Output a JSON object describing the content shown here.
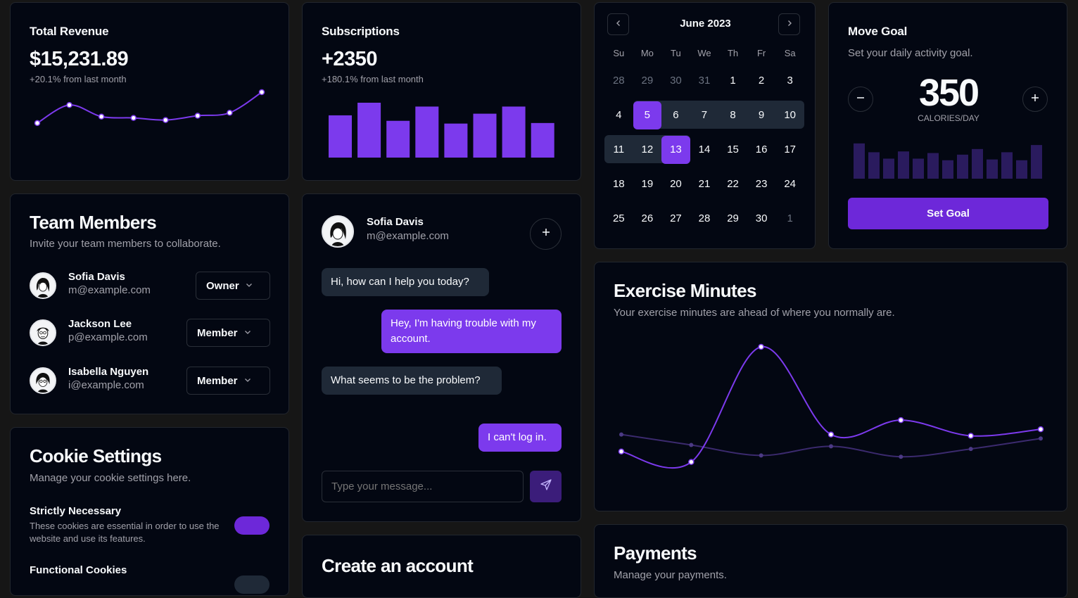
{
  "revenue": {
    "title": "Total Revenue",
    "value": "$15,231.89",
    "change": "+20.1% from last month",
    "points": [
      0.28,
      0.7,
      0.43,
      0.4,
      0.35,
      0.45,
      0.52,
      1.0
    ]
  },
  "subs": {
    "title": "Subscriptions",
    "value": "+2350",
    "change": "+180.1% from last month",
    "bars": [
      0.77,
      1.0,
      0.67,
      0.93,
      0.62,
      0.8,
      0.93,
      0.63
    ]
  },
  "calendar": {
    "month": "June 2023",
    "weekdays": [
      "Su",
      "Mo",
      "Tu",
      "We",
      "Th",
      "Fr",
      "Sa"
    ],
    "weeks": [
      [
        "28",
        "29",
        "30",
        "31",
        "1",
        "2",
        "3"
      ],
      [
        "4",
        "5",
        "6",
        "7",
        "8",
        "9",
        "10"
      ],
      [
        "11",
        "12",
        "13",
        "14",
        "15",
        "16",
        "17"
      ],
      [
        "18",
        "19",
        "20",
        "21",
        "22",
        "23",
        "24"
      ],
      [
        "25",
        "26",
        "27",
        "28",
        "29",
        "30",
        "1"
      ]
    ]
  },
  "goal": {
    "title": "Move Goal",
    "desc": "Set your daily activity goal.",
    "value": "350",
    "unit": "CALORIES/DAY",
    "button": "Set Goal",
    "bars": [
      0.88,
      0.66,
      0.5,
      0.68,
      0.5,
      0.64,
      0.46,
      0.6,
      0.74,
      0.48,
      0.66,
      0.46,
      0.84
    ]
  },
  "team": {
    "title": "Team Members",
    "desc": "Invite your team members to collaborate.",
    "members": [
      {
        "name": "Sofia Davis",
        "email": "m@example.com",
        "role": "Owner"
      },
      {
        "name": "Jackson Lee",
        "email": "p@example.com",
        "role": "Member"
      },
      {
        "name": "Isabella Nguyen",
        "email": "i@example.com",
        "role": "Member"
      }
    ]
  },
  "chat": {
    "name": "Sofia Davis",
    "email": "m@example.com",
    "messages": [
      {
        "text": "Hi, how can I help you today?",
        "from": "agent"
      },
      {
        "text": "Hey, I'm having trouble with my account.",
        "from": "user"
      },
      {
        "text": "What seems to be the problem?",
        "from": "agent"
      },
      {
        "text": "I can't log in.",
        "from": "user"
      }
    ],
    "placeholder": "Type your message..."
  },
  "exercise": {
    "title": "Exercise Minutes",
    "desc": "Your exercise minutes are ahead of where you normally are.",
    "current": [
      0.2,
      0.12,
      1.0,
      0.33,
      0.44,
      0.32,
      0.37
    ],
    "average": [
      0.33,
      0.25,
      0.17,
      0.24,
      0.16,
      0.22,
      0.3
    ]
  },
  "cookies": {
    "title": "Cookie Settings",
    "desc": "Manage your cookie settings here.",
    "items": [
      {
        "label": "Strictly Necessary",
        "desc": "These cookies are essential in order to use the website and use its features.",
        "on": true
      },
      {
        "label": "Functional Cookies",
        "desc": "",
        "on": false
      }
    ]
  },
  "account": {
    "title": "Create an account"
  },
  "payments": {
    "title": "Payments",
    "desc": "Manage your payments."
  },
  "colors": {
    "accent": "#7c3aed",
    "card": "#030712",
    "muted": "#a1a1aa"
  }
}
